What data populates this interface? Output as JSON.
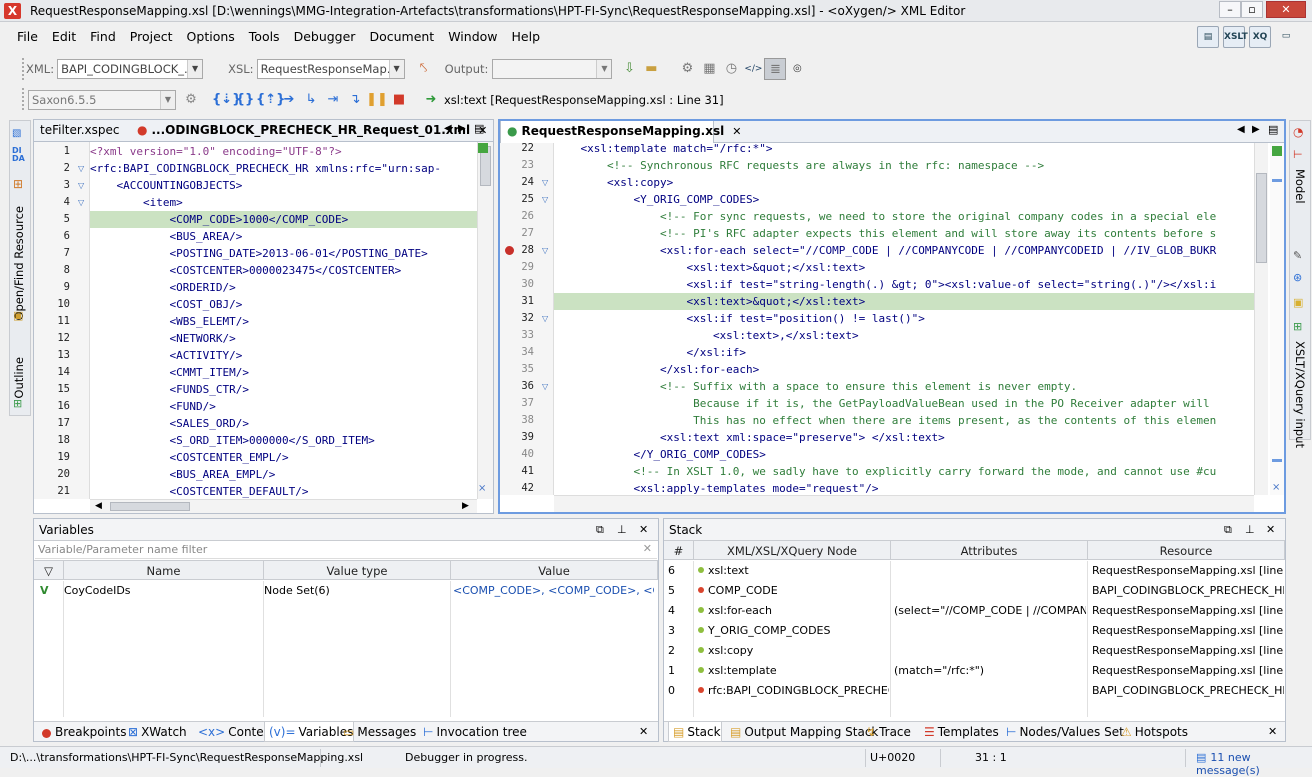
{
  "window": {
    "title": "RequestResponseMapping.xsl [D:\\wennings\\MMG-Integration-Artefacts\\transformations\\HPT-FI-Sync\\RequestResponseMapping.xsl] - <oXygen/> XML Editor",
    "app_icon": "X"
  },
  "menu": [
    "File",
    "Edit",
    "Find",
    "Project",
    "Options",
    "Tools",
    "Debugger",
    "Document",
    "Window",
    "Help"
  ],
  "toolbar": {
    "xml_label": "XML:",
    "xml_value": "BAPI_CODINGBLOCK_...",
    "xsl_label": "XSL:",
    "xsl_value": "RequestResponseMap...",
    "output_label": "Output:",
    "output_value": "",
    "engine_value": "Saxon6.5.5",
    "status": "xsl:text [RequestResponseMapping.xsl : Line 31]",
    "perspective_icons": [
      "XSLT",
      "XQ"
    ]
  },
  "left_editor": {
    "tabs": [
      "teFilter.xspec",
      "...ODINGBLOCK_PRECHECK_HR_Request_01.xml"
    ],
    "lines": [
      {
        "n": "1",
        "t": "<?xml version=\"1.0\" encoding=\"UTF-8\"?>"
      },
      {
        "n": "2",
        "t": "<rfc:BAPI_CODINGBLOCK_PRECHECK_HR xmlns:rfc=\"urn:sap-"
      },
      {
        "n": "3",
        "t": "    <ACCOUNTINGOBJECTS>"
      },
      {
        "n": "4",
        "t": "        <item>"
      },
      {
        "n": "5",
        "t": "            <COMP_CODE>1000</COMP_CODE>"
      },
      {
        "n": "6",
        "t": "            <BUS_AREA/>"
      },
      {
        "n": "7",
        "t": "            <POSTING_DATE>2013-06-01</POSTING_DATE>"
      },
      {
        "n": "8",
        "t": "            <COSTCENTER>0000023475</COSTCENTER>"
      },
      {
        "n": "9",
        "t": "            <ORDERID/>"
      },
      {
        "n": "10",
        "t": "            <COST_OBJ/>"
      },
      {
        "n": "11",
        "t": "            <WBS_ELEMT/>"
      },
      {
        "n": "12",
        "t": "            <NETWORK/>"
      },
      {
        "n": "13",
        "t": "            <ACTIVITY/>"
      },
      {
        "n": "14",
        "t": "            <CMMT_ITEM/>"
      },
      {
        "n": "15",
        "t": "            <FUNDS_CTR/>"
      },
      {
        "n": "16",
        "t": "            <FUND/>"
      },
      {
        "n": "17",
        "t": "            <SALES_ORD/>"
      },
      {
        "n": "18",
        "t": "            <S_ORD_ITEM>000000</S_ORD_ITEM>"
      },
      {
        "n": "19",
        "t": "            <COSTCENTER_EMPL/>"
      },
      {
        "n": "20",
        "t": "            <BUS_AREA_EMPL/>"
      },
      {
        "n": "21",
        "t": "            <COSTCENTER_DEFAULT/>"
      }
    ]
  },
  "right_editor": {
    "tab": "RequestResponseMapping.xsl",
    "lines": [
      {
        "n": "22",
        "t": "    <xsl:template match=\"/rfc:*\">"
      },
      {
        "n": "23",
        "t": "        <!-- Synchronous RFC requests are always in the rfc: namespace -->"
      },
      {
        "n": "24",
        "t": "        <xsl:copy>"
      },
      {
        "n": "25",
        "t": "            <Y_ORIG_COMP_CODES>"
      },
      {
        "n": "26",
        "t": "                <!-- For sync requests, we need to store the original company codes in a special ele"
      },
      {
        "n": "27",
        "t": "                <!-- PI's RFC adapter expects this element and will store away its contents before s"
      },
      {
        "n": "28",
        "t": "                <xsl:for-each select=\"//COMP_CODE | //COMPANYCODE | //COMPANYCODEID | //IV_GLOB_BUKR"
      },
      {
        "n": "29",
        "t": "                    <xsl:text>&quot;</xsl:text>"
      },
      {
        "n": "30",
        "t": "                    <xsl:if test=\"string-length(.) &gt; 0\"><xsl:value-of select=\"string(.)\"/></xsl:i"
      },
      {
        "n": "31",
        "t": "                    <xsl:text>&quot;</xsl:text>"
      },
      {
        "n": "32",
        "t": "                    <xsl:if test=\"position() != last()\">"
      },
      {
        "n": "33",
        "t": "                        <xsl:text>,</xsl:text>"
      },
      {
        "n": "34",
        "t": "                    </xsl:if>"
      },
      {
        "n": "35",
        "t": "                </xsl:for-each>"
      },
      {
        "n": "36",
        "t": "                <!-- Suffix with a space to ensure this element is never empty."
      },
      {
        "n": "37",
        "t": "                     Because if it is, the GetPayloadValueBean used in the PO Receiver adapter will"
      },
      {
        "n": "38",
        "t": "                     This has no effect when there are items present, as the contents of this elemen"
      },
      {
        "n": "39",
        "t": "                <xsl:text xml:space=\"preserve\"> </xsl:text>"
      },
      {
        "n": "40",
        "t": "            </Y_ORIG_COMP_CODES>"
      },
      {
        "n": "41",
        "t": "            <!-- In XSLT 1.0, we sadly have to explicitly carry forward the mode, and cannot use #cu"
      },
      {
        "n": "42",
        "t": "            <xsl:apply-templates mode=\"request\"/>"
      }
    ]
  },
  "side_tabs_left": [
    "Open/Find Resource",
    "Outline"
  ],
  "side_tabs_right": [
    "Model",
    "XSLT/XQuery input"
  ],
  "variables": {
    "title": "Variables",
    "filter_placeholder": "Variable/Parameter name filter",
    "columns": [
      "Name",
      "Value type",
      "Value"
    ],
    "rows": [
      {
        "flag": "V",
        "name": "CoyCodeIDs",
        "type": "Node Set(6)",
        "value": "<COMP_CODE>, <COMP_CODE>, <C..."
      }
    ]
  },
  "stack": {
    "title": "Stack",
    "columns": [
      "#",
      "XML/XSL/XQuery Node",
      "Attributes",
      "Resource"
    ],
    "rows": [
      {
        "n": "6",
        "node": "xsl:text",
        "color": "#8fbf3f",
        "attr": "",
        "res": "RequestResponseMapping.xsl  [line: 31]"
      },
      {
        "n": "5",
        "node": "COMP_CODE",
        "color": "#d9452e",
        "attr": "",
        "res": "BAPI_CODINGBLOCK_PRECHECK_HR..."
      },
      {
        "n": "4",
        "node": "xsl:for-each",
        "color": "#8fbf3f",
        "attr": "(select=\"//COMP_CODE | //COMPANY...",
        "res": "RequestResponseMapping.xsl  [line: 28]"
      },
      {
        "n": "3",
        "node": "Y_ORIG_COMP_CODES",
        "color": "#8fbf3f",
        "attr": "",
        "res": "RequestResponseMapping.xsl  [line: 25]"
      },
      {
        "n": "2",
        "node": "xsl:copy",
        "color": "#8fbf3f",
        "attr": "",
        "res": "RequestResponseMapping.xsl  [line: 24]"
      },
      {
        "n": "1",
        "node": "xsl:template",
        "color": "#8fbf3f",
        "attr": "(match=\"/rfc:*\")",
        "res": "RequestResponseMapping.xsl  [line: 22]"
      },
      {
        "n": "0",
        "node": "rfc:BAPI_CODINGBLOCK_PRECHEC...",
        "color": "#d9452e",
        "attr": "",
        "res": "BAPI_CODINGBLOCK_PRECHECK_HR..."
      }
    ]
  },
  "bottom_tabs_left": [
    "Breakpoints",
    "XWatch",
    "Context",
    "Variables",
    "Messages",
    "Invocation tree"
  ],
  "bottom_tabs_right": [
    "Stack",
    "Output Mapping Stack",
    "Trace",
    "Templates",
    "Nodes/Values Set",
    "Hotspots"
  ],
  "statusbar": {
    "path": "D:\\...\\transformations\\HPT-FI-Sync\\RequestResponseMapping.xsl",
    "state": "Debugger in progress.",
    "unicode": "U+0020",
    "position": "31 : 1",
    "messages": "11 new message(s)"
  }
}
